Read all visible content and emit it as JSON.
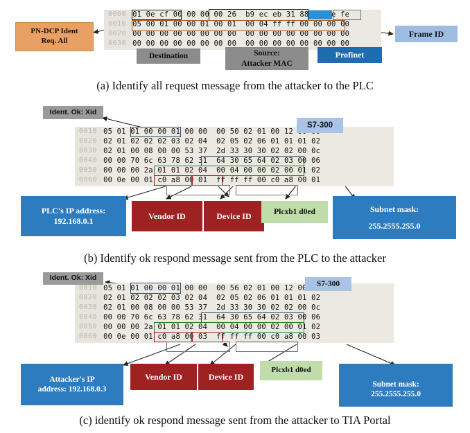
{
  "figure": {
    "panels": [
      {
        "id": "a",
        "caption": "(a) Identify all request message from the attacker to the PLC",
        "hex": {
          "rows": [
            {
              "offset": "0000",
              "bytes": "01 0e cf 00 00 00 00 26  b9 ec eb 31 88 92 fe fe"
            },
            {
              "offset": "0010",
              "bytes": "05 00 01 00 00 01 00 01  00 04 ff ff 00 00 00 00"
            },
            {
              "offset": "0020",
              "bytes": "00 00 00 00 00 00 00 00  00 00 00 00 00 00 00 00"
            },
            {
              "offset": "0030",
              "bytes": "00 00 00 00 00 00 00 00  00 00 00 00 00 00 00 00"
            }
          ]
        },
        "labels": {
          "pn_dcp": "PN-DCP Ident\nReq. All",
          "pn_dcp_line1": "PN-DCP Ident",
          "pn_dcp_line2": "Req. All",
          "destination": "Destination",
          "source_line1": "Source:",
          "source_line2": "Attacker MAC",
          "profinet": "Profinet",
          "frame_id": "Frame ID"
        }
      },
      {
        "id": "b",
        "caption": "(b) Identify ok respond message sent from the PLC to the attacker",
        "hex": {
          "rows": [
            {
              "offset": "0010",
              "bytes": "05 01 01 00 00 01 00 00  00 50 02 01 00 12 00 00"
            },
            {
              "offset": "0020",
              "bytes": "02 01 02 02 02 03 02 04  02 05 02 06 01 01 01 02"
            },
            {
              "offset": "0030",
              "bytes": "02 01 00 08 00 00 53 37  2d 33 30 30 02 02 00 0c"
            },
            {
              "offset": "0040",
              "bytes": "00 00 70 6c 63 78 62 31  64 30 65 64 02 03 00 06"
            },
            {
              "offset": "0050",
              "bytes": "00 00 00 2a 01 01 02 04  00 04 00 00 02 00 01 02"
            },
            {
              "offset": "0060",
              "bytes": "00 0e 00 01 c0 a8 00 01  ff ff ff 00 c0 a8 00 01"
            }
          ]
        },
        "labels": {
          "ident_ok": "Ident. Ok: Xid",
          "s7_300": "S7-300",
          "plc_ip_line1": "PLC's IP address:",
          "plc_ip_line2": "192.168.0.1",
          "vendor_id": "Vendor ID",
          "device_id": "Device ID",
          "plcxb1": "Plcxb1 d0ed",
          "subnet_line1": "Subnet mask:",
          "subnet_line2": "255.2555.255.0"
        }
      },
      {
        "id": "c",
        "caption": "(c) identify ok respond message sent from the attacker to TIA Portal",
        "hex": {
          "rows": [
            {
              "offset": "0010",
              "bytes": "05 01 01 00 00 01 00 00  00 56 02 01 00 12 00 00"
            },
            {
              "offset": "0020",
              "bytes": "02 01 02 02 02 03 02 04  02 05 02 06 01 01 01 02"
            },
            {
              "offset": "0030",
              "bytes": "02 01 00 08 00 00 53 37  2d 33 30 30 02 02 00 0c"
            },
            {
              "offset": "0040",
              "bytes": "00 00 70 6c 63 78 62 31  64 30 65 64 02 03 00 06"
            },
            {
              "offset": "0050",
              "bytes": "00 00 00 2a 01 01 02 04  00 04 00 00 02 00 01 02"
            },
            {
              "offset": "0060",
              "bytes": "00 0e 00 01 c0 a8 00 03  ff ff ff 00 c0 a8 00 03"
            }
          ]
        },
        "labels": {
          "ident_ok": "Ident. Ok: Xid",
          "s7_300": "S7-300",
          "attacker_ip_line1": "Attacker's IP",
          "attacker_ip_line2": "address: 192.168.0.3",
          "vendor_id": "Vendor ID",
          "device_id": "Device ID",
          "plcxb1": "Plcxb1 d0ed",
          "subnet_line1": "Subnet mask:",
          "subnet_line2": "255.2555.255.0"
        }
      }
    ]
  },
  "colors": {
    "orange_callout": "#e8a064",
    "gray_callout": "#8c8c8c",
    "blue_dark": "#1f6bb0",
    "blue_light": "#9ebce0",
    "blue_medium": "#2d7cc0",
    "red_callout": "#9e2222",
    "green_callout": "#c0dca8",
    "hex_background": "#ebe9e2",
    "offset_text": "#b9b6ae",
    "selection_blue": "#2d8fd5",
    "box_black": "#1a1a1a",
    "box_orange": "#b1561a",
    "box_navy": "#2e4a66",
    "box_green": "#2d7a2a",
    "box_red": "#9e2222",
    "box_gray": "#6e6e6e"
  }
}
